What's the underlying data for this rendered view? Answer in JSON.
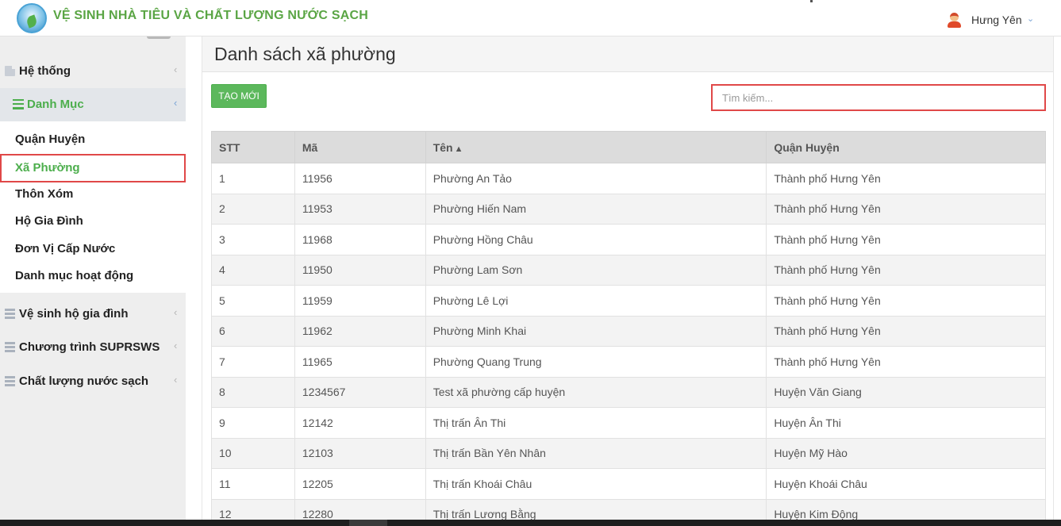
{
  "header": {
    "app_title": "VỆ SINH NHÀ TIÊU VÀ CHẤT LƯỢNG NƯỚC SẠCH",
    "user_name": "Hưng Yên",
    "user_caret": "⌄"
  },
  "sidebar": {
    "groups": [
      {
        "label": "Hệ thống",
        "icon": "file-icon"
      },
      {
        "label": "Danh Mục",
        "icon": "bars-icon"
      },
      {
        "label": "Vệ sinh hộ gia đình",
        "icon": "server-icon"
      },
      {
        "label": "Chương trình SUPRSWS",
        "icon": "server-icon"
      },
      {
        "label": "Chất lượng nước sạch",
        "icon": "server-icon"
      }
    ],
    "danh_muc_items": [
      {
        "label": "Quận Huyện"
      },
      {
        "label": "Xã Phường"
      },
      {
        "label": "Thôn Xóm"
      },
      {
        "label": "Hộ Gia Đình"
      },
      {
        "label": "Đơn Vị Cấp Nước"
      },
      {
        "label": "Danh mục hoạt động"
      }
    ],
    "chevron": "‹"
  },
  "main": {
    "page_title": "Danh sách xã phường",
    "create_button": "TẠO MỚI",
    "search_placeholder": "Tìm kiếm...",
    "table": {
      "columns": [
        "STT",
        "Mã",
        "Tên",
        "Quận Huyện"
      ],
      "sort_indicator": "▲",
      "rows": [
        [
          "1",
          "11956",
          "Phường An Tảo",
          "Thành phố Hưng Yên"
        ],
        [
          "2",
          "11953",
          "Phường Hiến Nam",
          "Thành phố Hưng Yên"
        ],
        [
          "3",
          "11968",
          "Phường Hồng Châu",
          "Thành phố Hưng Yên"
        ],
        [
          "4",
          "11950",
          "Phường Lam Sơn",
          "Thành phố Hưng Yên"
        ],
        [
          "5",
          "11959",
          "Phường Lê Lợi",
          "Thành phố Hưng Yên"
        ],
        [
          "6",
          "11962",
          "Phường Minh Khai",
          "Thành phố Hưng Yên"
        ],
        [
          "7",
          "11965",
          "Phường Quang Trung",
          "Thành phố Hưng Yên"
        ],
        [
          "8",
          "1234567",
          "Test xã phường cấp huyện",
          "Huyện Văn Giang"
        ],
        [
          "9",
          "12142",
          "Thị trấn Ân Thi",
          "Huyện Ân Thi"
        ],
        [
          "10",
          "12103",
          "Thị trấn Bần Yên Nhân",
          "Huyện Mỹ Hào"
        ],
        [
          "11",
          "12205",
          "Thị trấn Khoái Châu",
          "Huyện Khoái Châu"
        ],
        [
          "12",
          "12280",
          "Thị trấn Lương Bằng",
          "Huyện Kim Động"
        ]
      ]
    }
  },
  "colors": {
    "brand_green": "#5aa544",
    "button_green": "#5cb85c",
    "highlight_red": "#e04848",
    "sidebar_bg": "#eeeeee"
  }
}
